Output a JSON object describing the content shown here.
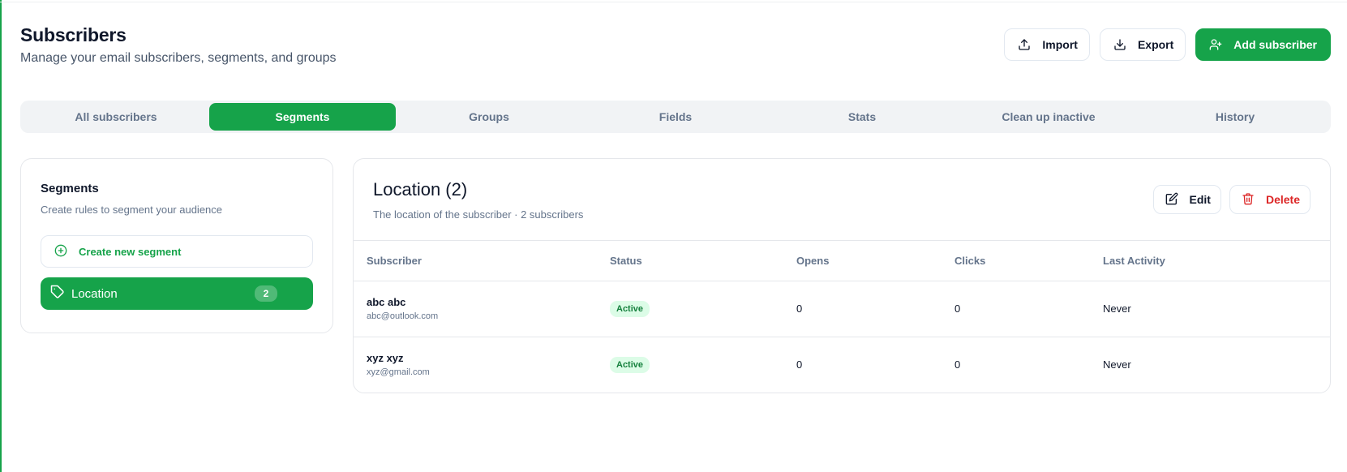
{
  "header": {
    "title": "Subscribers",
    "subtitle": "Manage your email subscribers, segments, and groups",
    "import_label": "Import",
    "export_label": "Export",
    "add_label": "Add subscriber"
  },
  "tabs": [
    {
      "label": "All subscribers",
      "active": false
    },
    {
      "label": "Segments",
      "active": true
    },
    {
      "label": "Groups",
      "active": false
    },
    {
      "label": "Fields",
      "active": false
    },
    {
      "label": "Stats",
      "active": false
    },
    {
      "label": "Clean up inactive",
      "active": false
    },
    {
      "label": "History",
      "active": false
    }
  ],
  "segments_panel": {
    "title": "Segments",
    "subtitle": "Create rules to segment your audience",
    "create_label": "Create new segment",
    "items": [
      {
        "label": "Location",
        "count": "2",
        "selected": true
      }
    ]
  },
  "detail": {
    "title": "Location (2)",
    "subtitle": "The location of the subscriber · 2 subscribers",
    "edit_label": "Edit",
    "delete_label": "Delete",
    "columns": [
      "Subscriber",
      "Status",
      "Opens",
      "Clicks",
      "Last Activity"
    ],
    "rows": [
      {
        "name": "abc abc",
        "email": "abc@outlook.com",
        "status": "Active",
        "opens": "0",
        "clicks": "0",
        "last_activity": "Never"
      },
      {
        "name": "xyz xyz",
        "email": "xyz@gmail.com",
        "status": "Active",
        "opens": "0",
        "clicks": "0",
        "last_activity": "Never"
      }
    ]
  },
  "colors": {
    "accent": "#16a34a",
    "danger": "#dc2626",
    "badge_bg": "#dcfce7",
    "badge_text": "#15803d"
  }
}
